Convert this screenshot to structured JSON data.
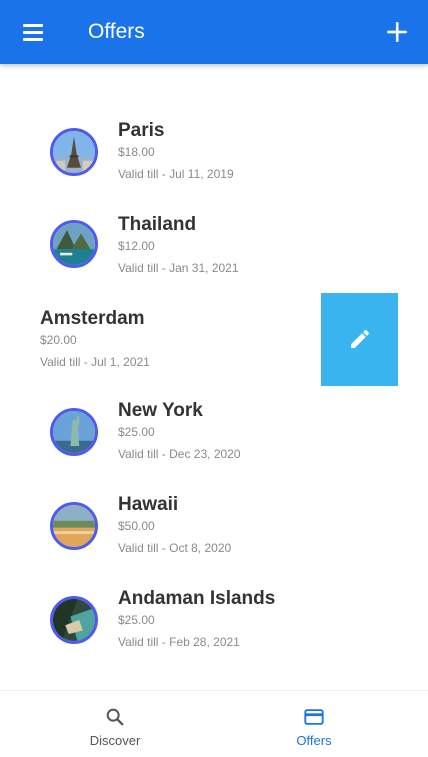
{
  "toolbar": {
    "title": "Offers",
    "menu_icon": "menu-icon",
    "add_icon": "add-icon"
  },
  "offers": [
    {
      "city": "Paris",
      "price": "$18.00",
      "valid": "Valid till -  Jul 11, 2019",
      "thumbnail": "eiffel-tower-photo"
    },
    {
      "city": "Thailand",
      "price": "$12.00",
      "valid": "Valid till -  Jan 31, 2021",
      "thumbnail": "thailand-islands-photo"
    },
    {
      "city": "Amsterdam",
      "price": "$20.00",
      "valid": "Valid till -  Jul 1, 2021",
      "swiped": true
    },
    {
      "city": "New York",
      "price": "$25.00",
      "valid": "Valid till -  Dec 23, 2020",
      "thumbnail": "statue-of-liberty-photo"
    },
    {
      "city": "Hawaii",
      "price": "$50.00",
      "valid": "Valid till -  Oct 8, 2020",
      "thumbnail": "hawaii-beach-photo"
    },
    {
      "city": "Andaman Islands",
      "price": "$25.00",
      "valid": "Valid till -  Feb 28, 2021",
      "thumbnail": "andaman-coast-photo"
    }
  ],
  "edit_action": {
    "icon": "pencil-icon",
    "color": "#3ab4ef"
  },
  "bottom_nav": {
    "tabs": [
      {
        "label": "Discover",
        "icon": "search-icon",
        "active": false
      },
      {
        "label": "Offers",
        "icon": "card-icon",
        "active": true
      }
    ]
  },
  "colors": {
    "primary": "#1a73e8",
    "avatar_border": "#4f5bf0",
    "swipe_action": "#3ab4ef"
  }
}
